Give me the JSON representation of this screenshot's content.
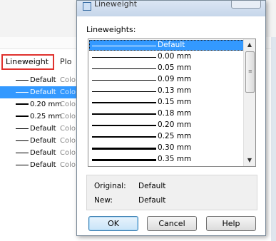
{
  "background": {
    "columns": {
      "lineweight": "Lineweight",
      "plot": "Plo"
    },
    "rows": [
      {
        "lineweight": "Default",
        "color": "Colo",
        "selected": false,
        "thick": false
      },
      {
        "lineweight": "Default",
        "color": "Colo",
        "selected": true,
        "thick": false
      },
      {
        "lineweight": "0.20 mm",
        "color": "Colo",
        "selected": false,
        "thick": true
      },
      {
        "lineweight": "0.25 mm",
        "color": "Colo",
        "selected": false,
        "thick": true
      },
      {
        "lineweight": "Default",
        "color": "Colo",
        "selected": false,
        "thick": false
      },
      {
        "lineweight": "Default",
        "color": "Colo",
        "selected": false,
        "thick": false
      },
      {
        "lineweight": "Default",
        "color": "Colo",
        "selected": false,
        "thick": false
      },
      {
        "lineweight": "Default",
        "color": "Colo",
        "selected": false,
        "thick": false
      }
    ]
  },
  "dialog": {
    "title": "Lineweight",
    "list_label": "Lineweights:",
    "items": [
      {
        "label": "Default",
        "selected": true
      },
      {
        "label": "0.00 mm",
        "selected": false
      },
      {
        "label": "0.05 mm",
        "selected": false
      },
      {
        "label": "0.09 mm",
        "selected": false
      },
      {
        "label": "0.13 mm",
        "selected": false
      },
      {
        "label": "0.15 mm",
        "selected": false
      },
      {
        "label": "0.18 mm",
        "selected": false
      },
      {
        "label": "0.20 mm",
        "selected": false
      },
      {
        "label": "0.25 mm",
        "selected": false
      },
      {
        "label": "0.30 mm",
        "selected": false
      },
      {
        "label": "0.35 mm",
        "selected": false
      }
    ],
    "original_label": "Original:",
    "original_value": "Default",
    "new_label": "New:",
    "new_value": "Default",
    "ok_label": "OK",
    "cancel_label": "Cancel",
    "help_label": "Help",
    "accent_color": "#3399ff"
  }
}
